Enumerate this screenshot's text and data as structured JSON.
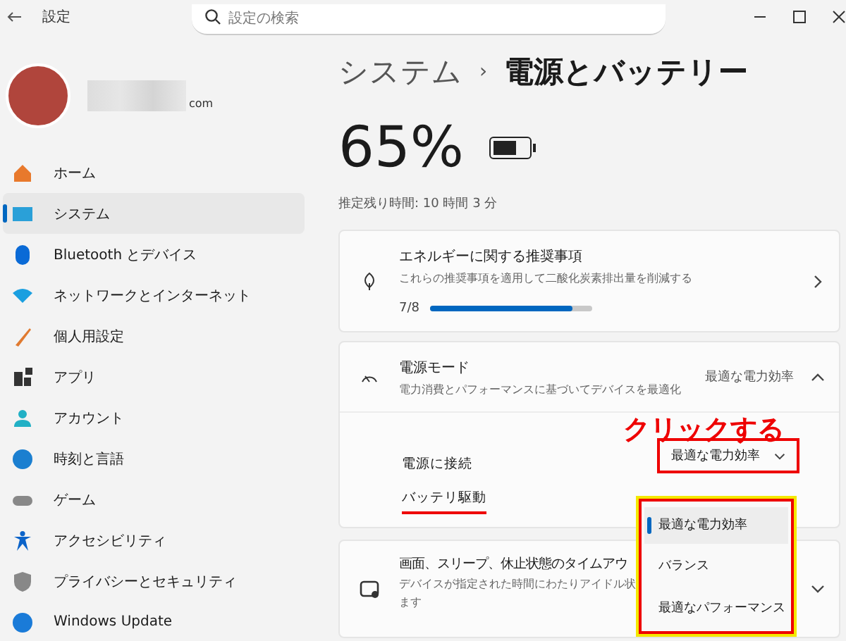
{
  "window": {
    "title": "設定"
  },
  "search": {
    "placeholder": "設定の検索"
  },
  "account": {
    "email_suffix": "com"
  },
  "sidebar": {
    "items": [
      {
        "label": "ホーム",
        "selected": false
      },
      {
        "label": "システム",
        "selected": true
      },
      {
        "label": "Bluetooth とデバイス",
        "selected": false
      },
      {
        "label": "ネットワークとインターネット",
        "selected": false
      },
      {
        "label": "個人用設定",
        "selected": false
      },
      {
        "label": "アプリ",
        "selected": false
      },
      {
        "label": "アカウント",
        "selected": false
      },
      {
        "label": "時刻と言語",
        "selected": false
      },
      {
        "label": "ゲーム",
        "selected": false
      },
      {
        "label": "アクセシビリティ",
        "selected": false
      },
      {
        "label": "プライバシーとセキュリティ",
        "selected": false
      },
      {
        "label": "Windows Update",
        "selected": false
      }
    ]
  },
  "breadcrumb": {
    "parent": "システム",
    "separator": "›",
    "current": "電源とバッテリー"
  },
  "battery": {
    "percent": "65%",
    "level": 0.65,
    "remaining": "推定残り時間: 10 時間 3 分"
  },
  "energy_card": {
    "title": "エネルギーに関する推奨事項",
    "subtitle": "これらの推奨事項を適用して二酸化炭素排出量を削減する",
    "count": "7/8",
    "level": 0.875
  },
  "power_mode_card": {
    "title": "電源モード",
    "subtitle": "電力消費とパフォーマンスに基づいてデバイスを最適化",
    "value": "最適な電力効率",
    "expanded": true,
    "rows": [
      {
        "label": "電源に接続",
        "value": "最適な電力効率"
      },
      {
        "label": "バッテリ駆動"
      }
    ]
  },
  "dropdown_menu": {
    "options": [
      {
        "label": "最適な電力効率",
        "selected": true
      },
      {
        "label": "バランス",
        "selected": false
      },
      {
        "label": "最適なパフォーマンス",
        "selected": false
      }
    ]
  },
  "screen_card": {
    "title": "画面、スリープ、休止状態のタイムアウ",
    "subtitle_lines": [
      "デバイスが指定された時間にわたりアイドル状",
      "ます"
    ],
    "expanded": false
  },
  "annotation": {
    "callout": "クリックする"
  }
}
